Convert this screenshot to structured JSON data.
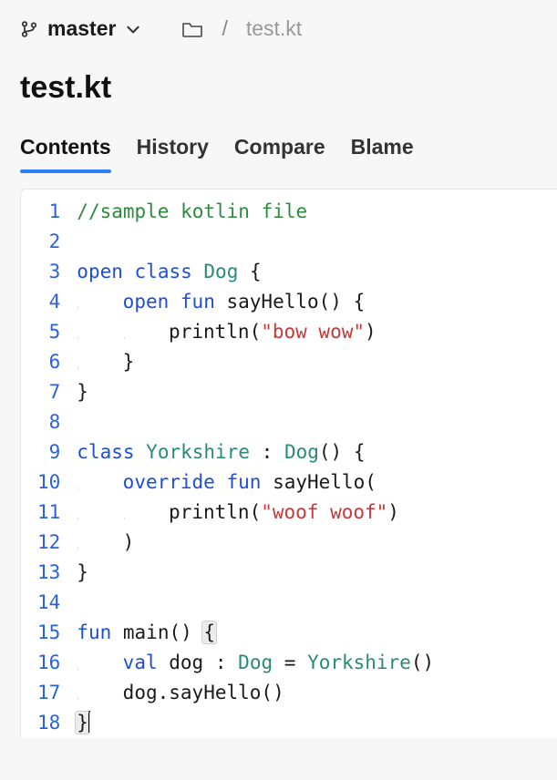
{
  "topbar": {
    "branch": "master",
    "crumb_file": "test.kt"
  },
  "title": "test.kt",
  "tabs": [
    {
      "id": "contents",
      "label": "Contents",
      "active": true
    },
    {
      "id": "history",
      "label": "History",
      "active": false
    },
    {
      "id": "compare",
      "label": "Compare",
      "active": false
    },
    {
      "id": "blame",
      "label": "Blame",
      "active": false
    }
  ],
  "code": {
    "language": "kotlin",
    "lines": [
      {
        "n": 1,
        "indent": 0,
        "tokens": [
          [
            "comment",
            "//sample kotlin file"
          ]
        ]
      },
      {
        "n": 2,
        "indent": 0,
        "tokens": []
      },
      {
        "n": 3,
        "indent": 0,
        "tokens": [
          [
            "kw",
            "open"
          ],
          [
            "sp",
            " "
          ],
          [
            "kw",
            "class"
          ],
          [
            "sp",
            " "
          ],
          [
            "type",
            "Dog"
          ],
          [
            "sp",
            " "
          ],
          [
            "punc",
            "{"
          ]
        ]
      },
      {
        "n": 4,
        "indent": 1,
        "tokens": [
          [
            "kw",
            "open"
          ],
          [
            "sp",
            " "
          ],
          [
            "kw",
            "fun"
          ],
          [
            "sp",
            " "
          ],
          [
            "ident",
            "sayHello"
          ],
          [
            "punc",
            "()"
          ],
          [
            "sp",
            " "
          ],
          [
            "punc",
            "{"
          ]
        ]
      },
      {
        "n": 5,
        "indent": 2,
        "tokens": [
          [
            "ident",
            "println"
          ],
          [
            "punc",
            "("
          ],
          [
            "str",
            "\"bow wow\""
          ],
          [
            "punc",
            ")"
          ]
        ]
      },
      {
        "n": 6,
        "indent": 1,
        "tokens": [
          [
            "punc",
            "}"
          ]
        ]
      },
      {
        "n": 7,
        "indent": 0,
        "tokens": [
          [
            "punc",
            "}"
          ]
        ]
      },
      {
        "n": 8,
        "indent": 0,
        "tokens": []
      },
      {
        "n": 9,
        "indent": 0,
        "tokens": [
          [
            "kw",
            "class"
          ],
          [
            "sp",
            " "
          ],
          [
            "type",
            "Yorkshire"
          ],
          [
            "sp",
            " "
          ],
          [
            "punc",
            ":"
          ],
          [
            "sp",
            " "
          ],
          [
            "type",
            "Dog"
          ],
          [
            "punc",
            "()"
          ],
          [
            "sp",
            " "
          ],
          [
            "punc",
            "{"
          ]
        ]
      },
      {
        "n": 10,
        "indent": 1,
        "tokens": [
          [
            "kw",
            "override"
          ],
          [
            "sp",
            " "
          ],
          [
            "kw",
            "fun"
          ],
          [
            "sp",
            " "
          ],
          [
            "ident",
            "sayHello"
          ],
          [
            "punc",
            "("
          ]
        ]
      },
      {
        "n": 11,
        "indent": 2,
        "tokens": [
          [
            "ident",
            "println"
          ],
          [
            "punc",
            "("
          ],
          [
            "str",
            "\"woof woof\""
          ],
          [
            "punc",
            ")"
          ]
        ]
      },
      {
        "n": 12,
        "indent": 1,
        "tokens": [
          [
            "punc",
            ")"
          ]
        ]
      },
      {
        "n": 13,
        "indent": 0,
        "tokens": [
          [
            "punc",
            "}"
          ]
        ]
      },
      {
        "n": 14,
        "indent": 0,
        "tokens": []
      },
      {
        "n": 15,
        "indent": 0,
        "tokens": [
          [
            "kw",
            "fun"
          ],
          [
            "sp",
            " "
          ],
          [
            "ident",
            "main"
          ],
          [
            "punc",
            "()"
          ],
          [
            "sp",
            " "
          ],
          [
            "match",
            "{"
          ]
        ]
      },
      {
        "n": 16,
        "indent": 1,
        "tokens": [
          [
            "kw",
            "val"
          ],
          [
            "sp",
            " "
          ],
          [
            "ident",
            "dog"
          ],
          [
            "sp",
            " "
          ],
          [
            "punc",
            ":"
          ],
          [
            "sp",
            " "
          ],
          [
            "type",
            "Dog"
          ],
          [
            "sp",
            " "
          ],
          [
            "punc",
            "="
          ],
          [
            "sp",
            " "
          ],
          [
            "type",
            "Yorkshire"
          ],
          [
            "punc",
            "()"
          ]
        ]
      },
      {
        "n": 17,
        "indent": 1,
        "tokens": [
          [
            "ident",
            "dog"
          ],
          [
            "punc",
            "."
          ],
          [
            "ident",
            "sayHello"
          ],
          [
            "punc",
            "()"
          ]
        ]
      },
      {
        "n": 18,
        "indent": 0,
        "tokens": [
          [
            "match",
            "}"
          ],
          [
            "caret",
            ""
          ]
        ]
      }
    ]
  }
}
